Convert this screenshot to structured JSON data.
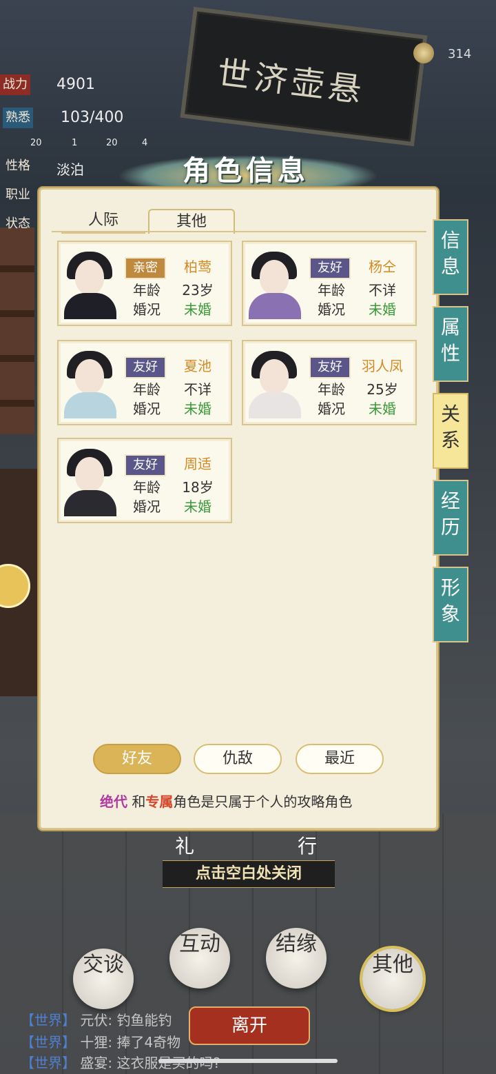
{
  "top": {
    "power_label": "战力",
    "power_value": "4901",
    "familiarity_label": "熟悉",
    "familiarity_value": "103/400",
    "mini_counts": [
      "20",
      "1",
      "20",
      "4"
    ],
    "personality_label": "性格",
    "personality_value": "淡泊",
    "job_label": "职业",
    "state_label": "状态",
    "currency_value": "314"
  },
  "shop_sign": "世济壶悬",
  "panel": {
    "title": "角色信息",
    "tabs": [
      "人际",
      "其他"
    ],
    "active_tab": "其他",
    "characters": [
      {
        "relation": "亲密",
        "relation_type": "intimate",
        "name": "柏莺",
        "age_label": "年龄",
        "age": "23岁",
        "marital_label": "婚况",
        "marital": "未婚"
      },
      {
        "relation": "友好",
        "relation_type": "friendly",
        "name": "杨仝",
        "age_label": "年龄",
        "age": "不详",
        "marital_label": "婚况",
        "marital": "未婚"
      },
      {
        "relation": "友好",
        "relation_type": "friendly",
        "name": "夏池",
        "age_label": "年龄",
        "age": "不详",
        "marital_label": "婚况",
        "marital": "未婚"
      },
      {
        "relation": "友好",
        "relation_type": "friendly",
        "name": "羽人凤",
        "age_label": "年龄",
        "age": "25岁",
        "marital_label": "婚况",
        "marital": "未婚"
      },
      {
        "relation": "友好",
        "relation_type": "friendly",
        "name": "周适",
        "age_label": "年龄",
        "age": "18岁",
        "marital_label": "婚况",
        "marital": "未婚"
      }
    ],
    "filters": [
      "好友",
      "仇敌",
      "最近"
    ],
    "active_filter": "好友",
    "note_part1": "绝代",
    "note_and": "和",
    "note_part2": "专属",
    "note_rest": "角色是只属于个人的攻略角色"
  },
  "side_tabs": [
    "信息",
    "属性",
    "关系",
    "经历",
    "形象"
  ],
  "active_side_tab": "关系",
  "close_hint": "点击空白处关闭",
  "under_panel": [
    "礼",
    "行"
  ],
  "actions": [
    "交谈",
    "互动",
    "结缘",
    "其他"
  ],
  "chat": [
    {
      "tag": "【世界】",
      "text": "元伏: 钓鱼能钓"
    },
    {
      "tag": "【世界】",
      "text": "十狸: 捧了4奇物"
    },
    {
      "tag": "【世界】",
      "text": "盛宴: 这衣服是买的吗?"
    }
  ],
  "leave_label": "离开",
  "colors": {
    "teal_tab": "#3f8f8e",
    "gold": "#dbb458",
    "friendly_badge": "#5a5689",
    "intimate_badge": "#c08a3e"
  }
}
